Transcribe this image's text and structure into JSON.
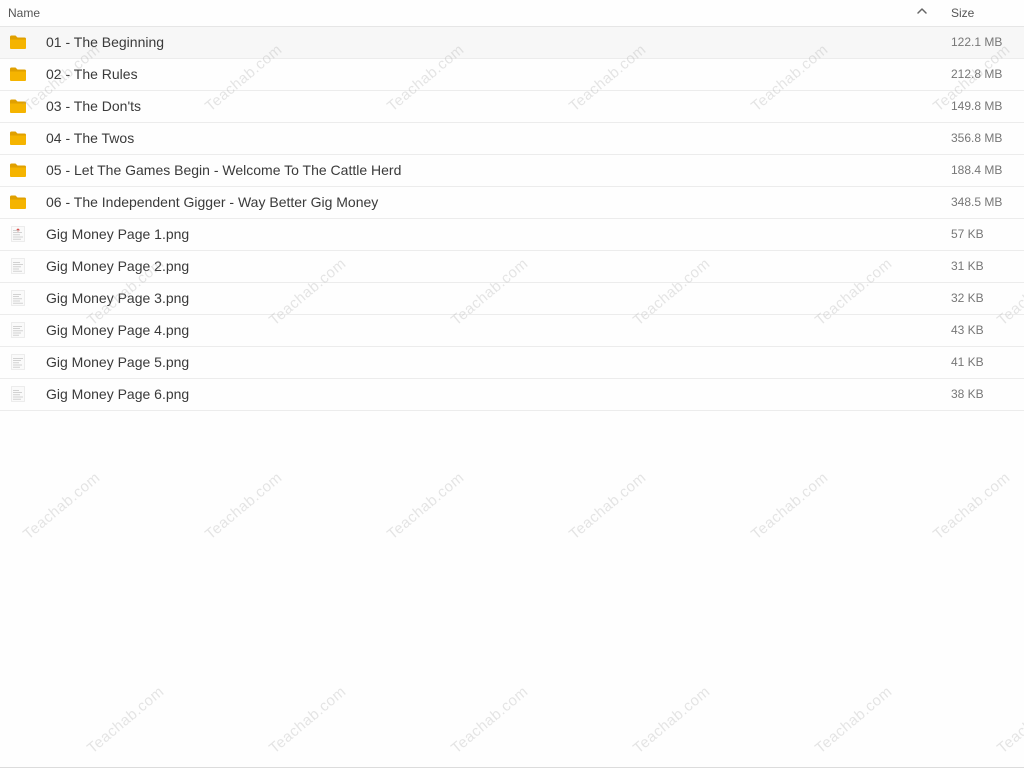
{
  "header": {
    "name_label": "Name",
    "size_label": "Size",
    "sort_icon": "chevron-up-icon"
  },
  "files": [
    {
      "name": "01 - The Beginning",
      "size": "122.1 MB",
      "type": "folder"
    },
    {
      "name": "02 - The Rules",
      "size": "212.8 MB",
      "type": "folder"
    },
    {
      "name": "03 - The Don'ts",
      "size": "149.8 MB",
      "type": "folder"
    },
    {
      "name": "04 - The Twos",
      "size": "356.8 MB",
      "type": "folder"
    },
    {
      "name": "05 - Let The Games Begin - Welcome To The Cattle Herd",
      "size": "188.4 MB",
      "type": "folder"
    },
    {
      "name": "06 - The Independent Gigger - Way Better Gig Money",
      "size": "348.5 MB",
      "type": "folder"
    },
    {
      "name": "Gig Money Page 1.png",
      "size": "57 KB",
      "type": "image"
    },
    {
      "name": "Gig Money Page 2.png",
      "size": "31 KB",
      "type": "image"
    },
    {
      "name": "Gig Money Page 3.png",
      "size": "32 KB",
      "type": "image"
    },
    {
      "name": "Gig Money Page 4.png",
      "size": "43 KB",
      "type": "image"
    },
    {
      "name": "Gig Money Page 5.png",
      "size": "41 KB",
      "type": "image"
    },
    {
      "name": "Gig Money Page 6.png",
      "size": "38 KB",
      "type": "image"
    }
  ],
  "watermark_text": "Teachab.com",
  "colors": {
    "folder": "#f5b400",
    "folder_tab": "#e0a000",
    "accent_red": "#d9534f"
  }
}
